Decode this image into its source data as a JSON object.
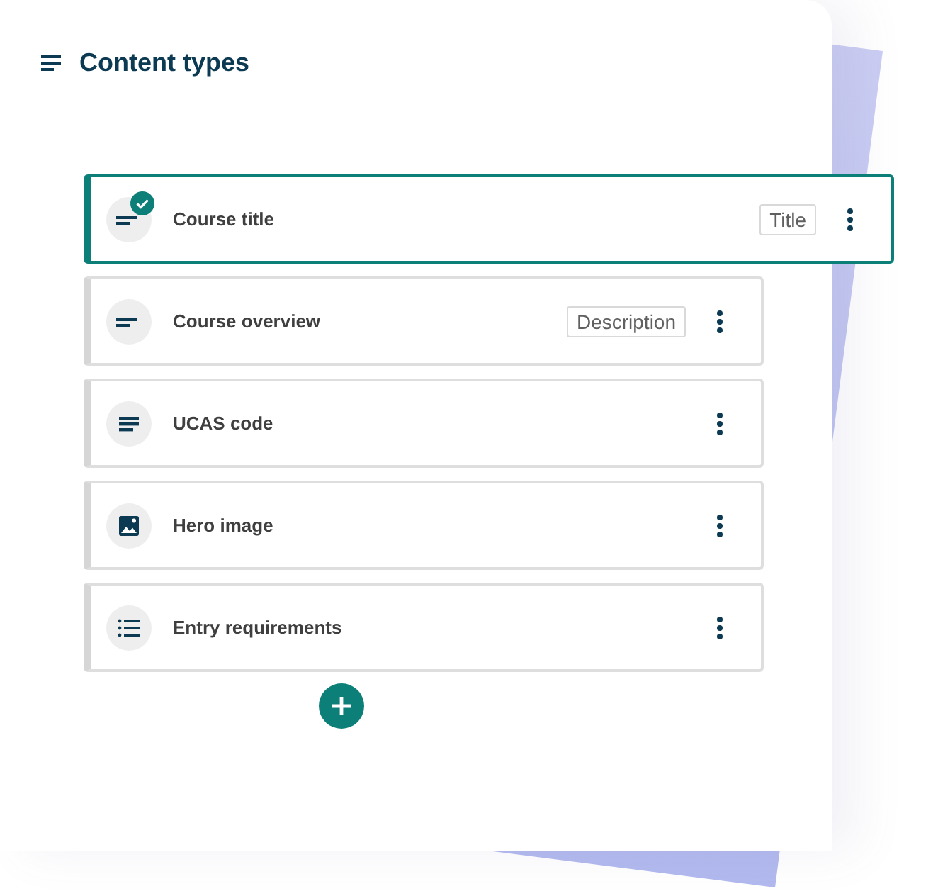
{
  "header": {
    "title": "Content types"
  },
  "items": [
    {
      "label": "Course title",
      "kind": "shorttext",
      "tag": "Title",
      "selected": true
    },
    {
      "label": "Course overview",
      "kind": "shorttext",
      "tag": "Description",
      "selected": false
    },
    {
      "label": "UCAS code",
      "kind": "text",
      "selected": false
    },
    {
      "label": "Hero image",
      "kind": "image",
      "selected": false
    },
    {
      "label": "Entry requirements",
      "kind": "list",
      "selected": false
    }
  ]
}
